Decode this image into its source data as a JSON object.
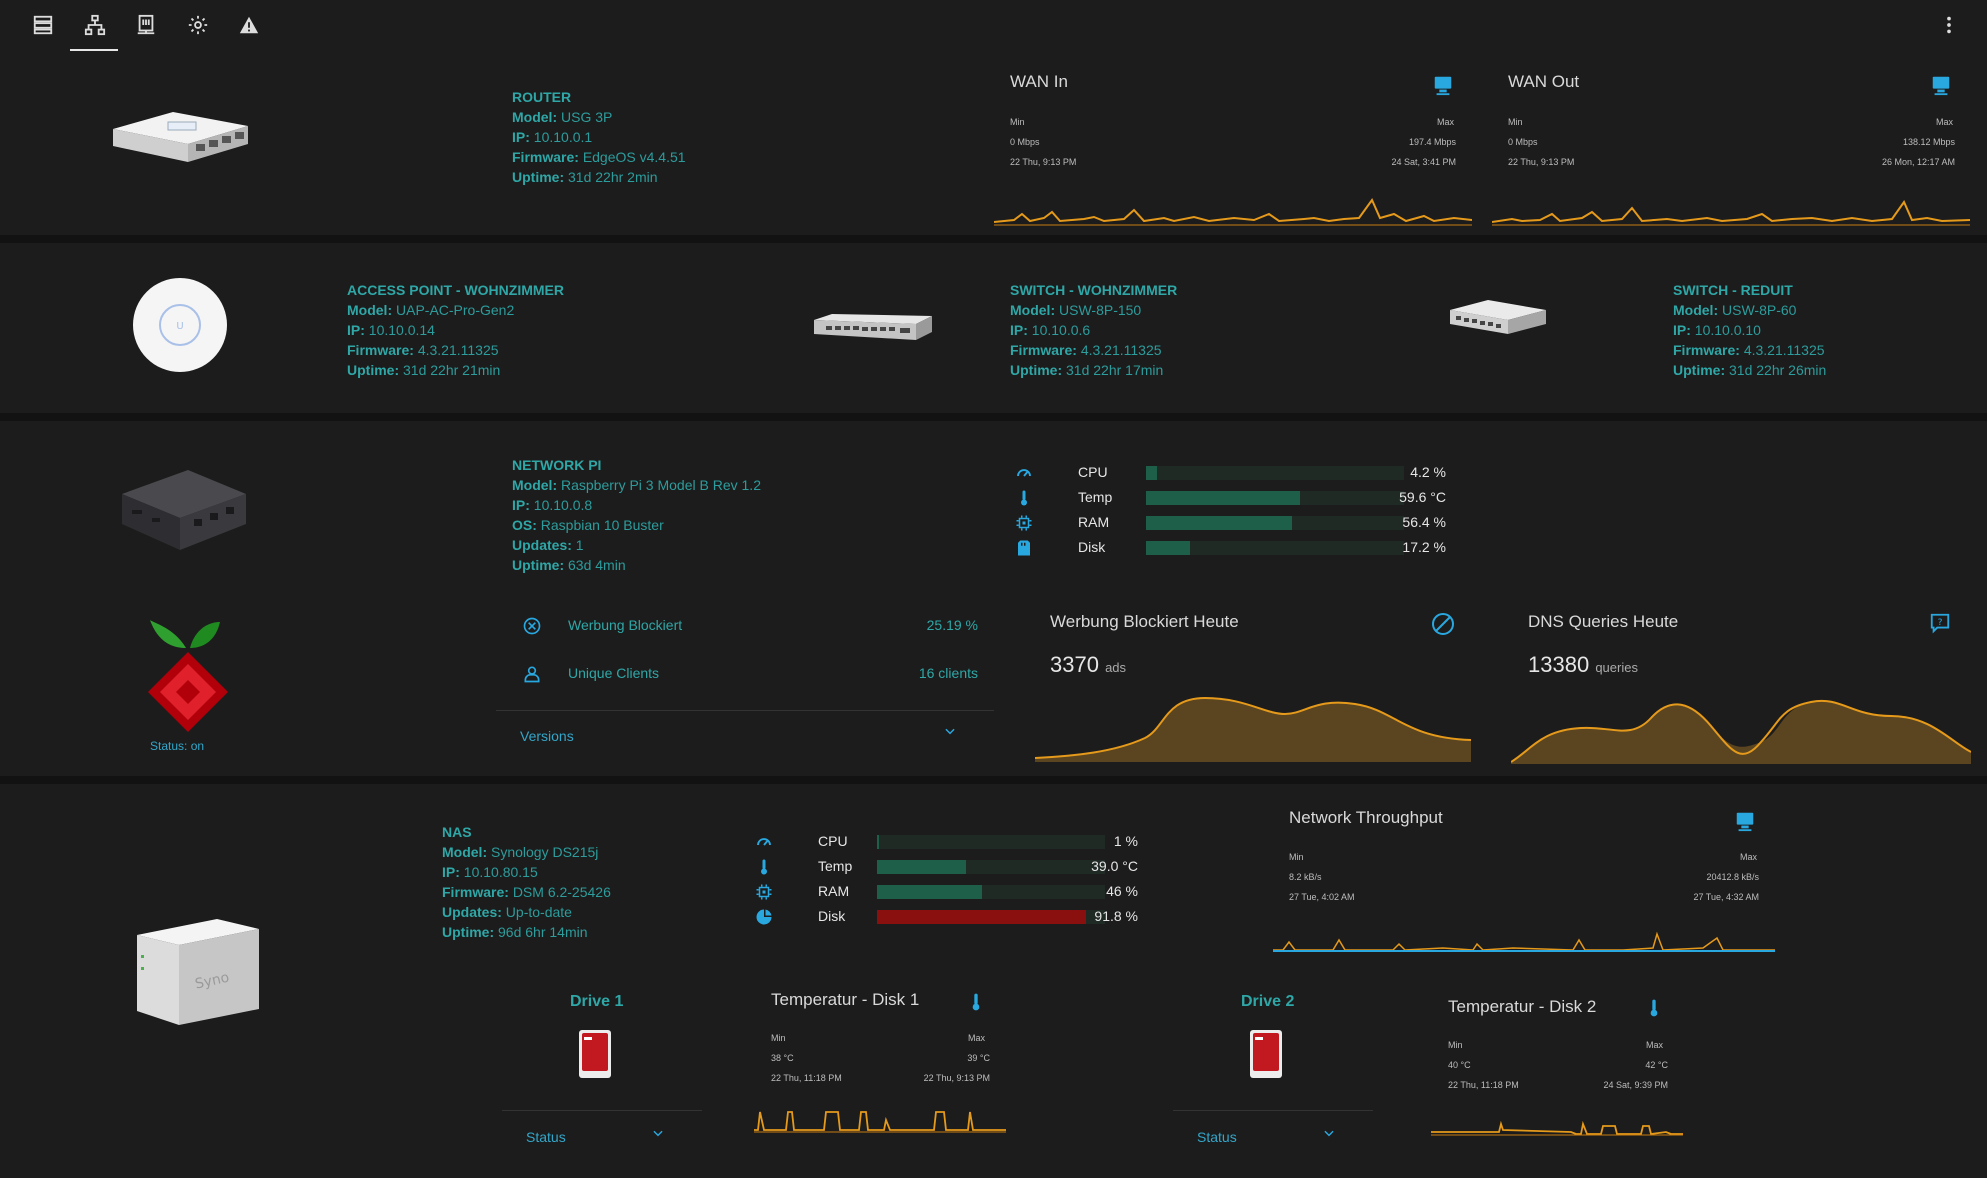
{
  "nav": {
    "icons": [
      "server-list-icon",
      "network-topology-icon",
      "nas-icon",
      "gear-icon",
      "warning-icon"
    ],
    "more_icon": "more-vert-icon"
  },
  "router": {
    "title": "ROUTER",
    "model_key": "Model:",
    "model": "USG 3P",
    "ip_key": "IP:",
    "ip": "10.10.0.1",
    "fw_key": "Firmware:",
    "firmware": "EdgeOS v4.4.51",
    "up_key": "Uptime:",
    "uptime": "31d 22hr 2min"
  },
  "wan_in": {
    "title": "WAN In",
    "min_label": "Min",
    "max_label": "Max",
    "min_value": "0 Mbps",
    "max_value": "197.4 Mbps",
    "min_time": "22 Thu, 9:13 PM",
    "max_time": "24 Sat, 3:41 PM"
  },
  "wan_out": {
    "title": "WAN Out",
    "min_label": "Min",
    "max_label": "Max",
    "min_value": "0 Mbps",
    "max_value": "138.12 Mbps",
    "min_time": "22 Thu, 9:13 PM",
    "max_time": "26 Mon, 12:17 AM"
  },
  "ap": {
    "title": "ACCESS POINT - WOHNZIMMER",
    "model_key": "Model:",
    "model": "UAP-AC-Pro-Gen2",
    "ip_key": "IP:",
    "ip": "10.10.0.14",
    "fw_key": "Firmware:",
    "firmware": "4.3.21.11325",
    "up_key": "Uptime:",
    "uptime": "31d 22hr 21min"
  },
  "sw1": {
    "title": "SWITCH - WOHNZIMMER",
    "model_key": "Model:",
    "model": "USW-8P-150",
    "ip_key": "IP:",
    "ip": "10.10.0.6",
    "fw_key": "Firmware:",
    "firmware": "4.3.21.11325",
    "up_key": "Uptime:",
    "uptime": "31d 22hr 17min"
  },
  "sw2": {
    "title": "SWITCH - REDUIT",
    "model_key": "Model:",
    "model": "USW-8P-60",
    "ip_key": "IP:",
    "ip": "10.10.0.10",
    "fw_key": "Firmware:",
    "firmware": "4.3.21.11325",
    "up_key": "Uptime:",
    "uptime": "31d 22hr 26min"
  },
  "pi": {
    "title": "NETWORK PI",
    "model_key": "Model:",
    "model": "Raspberry Pi 3 Model B Rev 1.2",
    "ip_key": "IP:",
    "ip": "10.10.0.8",
    "os_key": "OS:",
    "os": "Raspbian 10 Buster",
    "upd_key": "Updates:",
    "updates": "1",
    "up_key": "Uptime:",
    "uptime": "63d 4min",
    "bars": [
      {
        "icon": "gauge-icon",
        "label": "CPU",
        "value": "4.2 %",
        "pct": 4.2
      },
      {
        "icon": "thermometer-icon",
        "label": "Temp",
        "value": "59.6 °C",
        "pct": 59.6
      },
      {
        "icon": "chip-icon",
        "label": "RAM",
        "value": "56.4 %",
        "pct": 56.4
      },
      {
        "icon": "sd-card-icon",
        "label": "Disk",
        "value": "17.2 %",
        "pct": 17.2
      }
    ]
  },
  "pihole": {
    "status": "Status: on",
    "blocked_label": "Werbung Blockiert",
    "blocked_value": "25.19 %",
    "clients_label": "Unique Clients",
    "clients_value": "16 clients",
    "versions_label": "Versions"
  },
  "ads_card": {
    "title": "Werbung Blockiert Heute",
    "value": "3370",
    "unit": "ads"
  },
  "dns_card": {
    "title": "DNS Queries Heute",
    "value": "13380",
    "unit": "queries"
  },
  "nas": {
    "title": "NAS",
    "model_key": "Model:",
    "model": "Synology DS215j",
    "ip_key": "IP:",
    "ip": "10.10.80.15",
    "fw_key": "Firmware:",
    "firmware": "DSM 6.2-25426",
    "upd_key": "Updates:",
    "updates": "Up-to-date",
    "up_key": "Uptime:",
    "uptime": "96d 6hr 14min",
    "bars": [
      {
        "icon": "gauge-icon",
        "label": "CPU",
        "value": "1 %",
        "pct": 1,
        "color": "#1d5f49"
      },
      {
        "icon": "thermometer-icon",
        "label": "Temp",
        "value": "39.0 °C",
        "pct": 39,
        "color": "#1d5f49"
      },
      {
        "icon": "chip-icon",
        "label": "RAM",
        "value": "46 %",
        "pct": 46,
        "color": "#1d5f49"
      },
      {
        "icon": "pie-icon",
        "label": "Disk",
        "value": "91.8 %",
        "pct": 91.8,
        "color": "#8a1010"
      }
    ]
  },
  "throughput": {
    "title": "Network Throughput",
    "min_label": "Min",
    "max_label": "Max",
    "min_value": "8.2 kB/s",
    "max_value": "20412.8 kB/s",
    "min_time": "27 Tue, 4:02 AM",
    "max_time": "27 Tue, 4:32 AM"
  },
  "drive1": {
    "title": "Drive 1",
    "status": "Status"
  },
  "drive2": {
    "title": "Drive 2",
    "status": "Status"
  },
  "temp1": {
    "title": "Temperatur - Disk 1",
    "min_label": "Min",
    "max_label": "Max",
    "min_value": "38 °C",
    "max_value": "39 °C",
    "min_time": "22 Thu, 11:18 PM",
    "max_time": "22 Thu, 9:13 PM"
  },
  "temp2": {
    "title": "Temperatur - Disk 2",
    "min_label": "Min",
    "max_label": "Max",
    "min_value": "40 °C",
    "max_value": "42 °C",
    "min_time": "22 Thu, 11:18 PM",
    "max_time": "24 Sat, 9:39 PM"
  },
  "colors": {
    "accent": "#2fa7a7",
    "chart": "#e59a1b",
    "blue": "#29a8e0",
    "bar_ok": "#1d5f49",
    "bar_crit": "#8a1010"
  }
}
